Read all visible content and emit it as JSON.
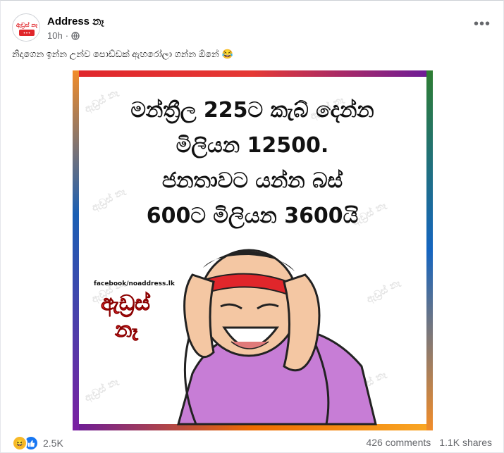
{
  "post": {
    "author": "Address නෑ",
    "time": "10h",
    "caption": "නිදාගෙන ඉන්න උන්ව පොඩ්ඩක් ඇහරෝලා ගන්න ඕනේ",
    "caption_emoji": "😂",
    "avatar_text": "ඇඩ්‍රස් නෑ"
  },
  "image": {
    "lines": [
      "මන්ත්‍රීල 225ට කැබ් දෙන්න",
      "මිලියන 12500.",
      "ජනතාවට යන්න බස්",
      "600ට මිලියන 3600යි"
    ],
    "fb_handle": "facebook/noaddress.lk",
    "logo_text_1": "ඇඩ්‍රස්",
    "logo_text_2": "නෑ",
    "watermark": "ඇඩ්‍රස් නෑ noaddress.lk"
  },
  "reactions": {
    "count": "2.5K",
    "comments": "426 comments",
    "shares": "1.1K shares",
    "icons": [
      "haha-icon",
      "like-icon"
    ]
  },
  "colors": {
    "frame_top": "#e0262b",
    "frame_left": "#1a5fb4",
    "frame_right": "#2e7d32",
    "frame_bottom": "#f28c28",
    "like_blue": "#1877f2",
    "haha_yellow": "#f7b928"
  }
}
